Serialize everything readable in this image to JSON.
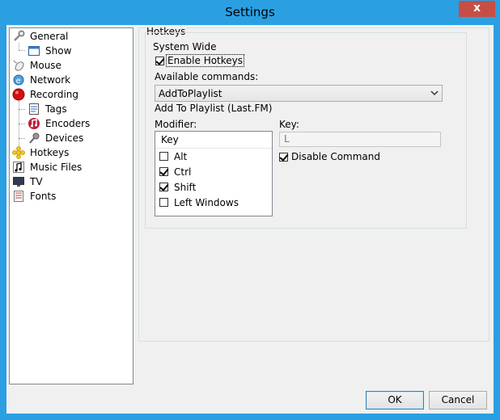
{
  "window": {
    "title": "Settings",
    "close_symbol": "x"
  },
  "tree": {
    "items": [
      {
        "label": "General",
        "icon": "wrench-icon"
      },
      {
        "label": "Show",
        "icon": "window-icon"
      },
      {
        "label": "Mouse",
        "icon": "mouse-icon"
      },
      {
        "label": "Network",
        "icon": "network-icon"
      },
      {
        "label": "Recording",
        "icon": "record-icon"
      },
      {
        "label": "Tags",
        "icon": "tags-icon"
      },
      {
        "label": "Encoders",
        "icon": "encoder-icon"
      },
      {
        "label": "Devices",
        "icon": "microphone-icon"
      },
      {
        "label": "Hotkeys",
        "icon": "hotkeys-icon",
        "selected": true
      },
      {
        "label": "Music Files",
        "icon": "music-note-icon"
      },
      {
        "label": "TV",
        "icon": "tv-icon"
      },
      {
        "label": "Fonts",
        "icon": "fonts-icon"
      }
    ]
  },
  "hotkeys": {
    "panel_title": "Hotkeys",
    "group_title": "System Wide",
    "enable_label": "Enable Hotkeys",
    "enable_checked": true,
    "available_label": "Available commands:",
    "command_value": "AddToPlaylist",
    "command_description": "Add To Playlist (Last.FM)",
    "modifier_label": "Modifier:",
    "modifier_header": "Key",
    "modifiers": [
      {
        "label": "Alt",
        "checked": false
      },
      {
        "label": "Ctrl",
        "checked": true
      },
      {
        "label": "Shift",
        "checked": true
      },
      {
        "label": "Left Windows",
        "checked": false
      }
    ],
    "key_label": "Key:",
    "key_value": "L",
    "disable_label": "Disable Command",
    "disable_checked": true
  },
  "buttons": {
    "ok": "OK",
    "cancel": "Cancel"
  }
}
